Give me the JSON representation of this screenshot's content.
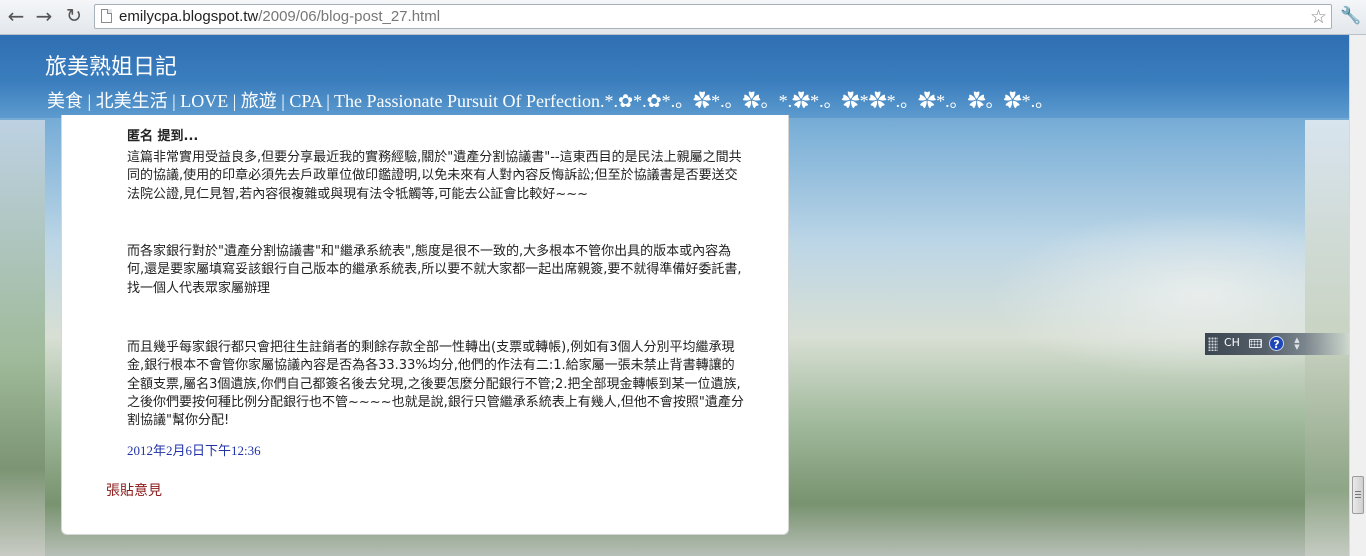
{
  "browser": {
    "url_host": "emilycpa.blogspot.tw",
    "url_path": "/2009/06/blog-post_27.html",
    "icons": [
      "back-arrow",
      "forward-arrow",
      "reload",
      "page",
      "star",
      "wrench"
    ]
  },
  "blog": {
    "title": "旅美熟姐日記",
    "tagline": "美食 | 北美生活 | LOVE | 旅遊 | CPA | The Passionate Pursuit Of Perfection.*.✿*.✿*.。✿*.。✿。*.✿*.。✿*✿*.。✿*.。✿。✿*.。"
  },
  "comment": {
    "author": "匿名 提到...",
    "paragraphs": [
      "這篇非常實用受益良多,但要分享最近我的實務經驗,關於\"遺產分割協議書\"--這東西目的是民法上親屬之間共同的協議,使用的印章必須先去戶政單位做印鑑證明,以免未來有人對內容反悔訴訟;但至於協議書是否要送交法院公證,見仁見智,若內容很複雜或與現有法令牴觸等,可能去公証會比較好~~~",
      "而各家銀行對於\"遺產分割協議書\"和\"繼承系統表\",態度是很不一致的,大多根本不管你出具的版本或內容為何,還是要家屬填寫妥該銀行自己版本的繼承系統表,所以要不就大家都一起出席親簽,要不就得準備好委託書,找一個人代表眾家屬辦理",
      "而且幾乎每家銀行都只會把往生註銷者的剩餘存款全部一性轉出(支票或轉帳),例如有3個人分別平均繼承現金,銀行根本不會管你家屬協議內容是否為各33.33%均分,他們的作法有二:1.給家屬一張未禁止背書轉讓的全額支票,屬名3個遺族,你們自己都簽名後去兌現,之後要怎麼分配銀行不管;2.把全部現金轉帳到某一位遺族,之後你們要按何種比例分配銀行也不管~~~~也就是說,銀行只管繼承系統表上有幾人,但他不會按照\"遺產分割協議\"幫你分配!"
    ],
    "timestamp": "2012年2月6日下午12:36"
  },
  "post_comment_label": "張貼意見",
  "ime": {
    "lang": "CH",
    "help": "?"
  },
  "colors": {
    "header_blue": "#3a7dbd",
    "timestamp_link": "#2233aa",
    "post_comment_link": "#8b1a1a"
  }
}
